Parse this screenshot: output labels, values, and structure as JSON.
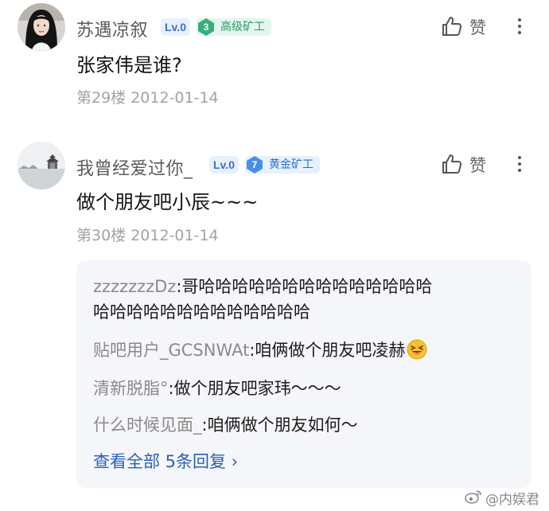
{
  "posts": [
    {
      "username": "苏遇凉叙",
      "level": "Lv.0",
      "medal_number": "3",
      "medal_label": "高级矿工",
      "like_label": "赞",
      "content": "张家伟是谁?",
      "meta": "第29楼  2012-01-14"
    },
    {
      "username": "我曾经爱过你_",
      "level": "Lv.0",
      "medal_number": "7",
      "medal_label": "黄金矿工",
      "like_label": "赞",
      "content": "做个朋友吧小辰~~~",
      "meta": "第30楼  2012-01-14"
    }
  ],
  "replies": [
    {
      "user": "zzzzzzzDz",
      "text_line1": "哥哈哈哈哈哈哈哈哈哈哈哈哈哈哈",
      "text_line2": "哈哈哈哈哈哈哈哈哈哈哈哈哈"
    },
    {
      "user": "贴吧用户_GCSNWAt",
      "text": "咱俩做个朋友吧凌赫",
      "emoji": "grinning-squint-emoji"
    },
    {
      "user": "清新脱脂°",
      "text": "做个朋友吧家玮～～～"
    },
    {
      "user": "什么时候见面_",
      "text": "咱俩做个朋友如何～"
    }
  ],
  "reply_separator": ":",
  "view_all_label": "查看全部 5条回复 ›",
  "watermark": "@内娱君",
  "colors": {
    "level_badge": "#3c6fc7",
    "medal_green": "#2a9a66",
    "medal_blue": "#2d6fd0",
    "link": "#2a5fb8",
    "reply_box_bg": "#f5f6f9"
  }
}
